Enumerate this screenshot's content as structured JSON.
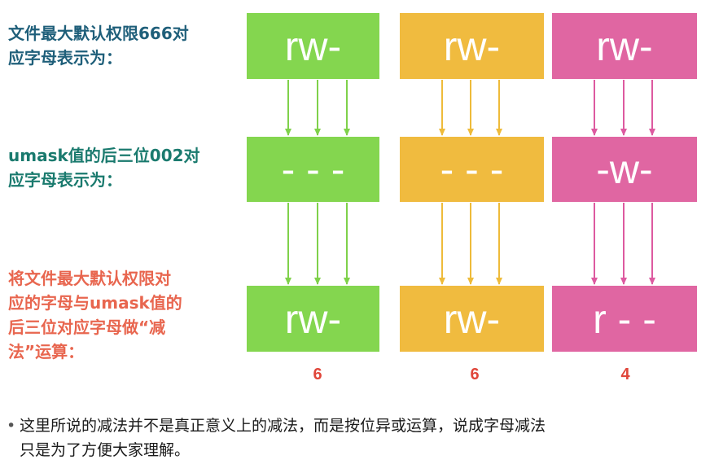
{
  "labels": {
    "row1": {
      "lines": [
        "文件最大默认权限666对",
        "应字母表示为："
      ],
      "color": "#1f5f7a"
    },
    "row2": {
      "lines": [
        "umask值的后三位002对",
        "应字母表示为："
      ],
      "color": "#1a7a6e"
    },
    "row3": {
      "lines": [
        "将文件最大默认权限对",
        "应的字母与umask值的",
        "后三位对应字母做“减",
        "法”运算："
      ],
      "color": "#e8664f"
    }
  },
  "columns": [
    {
      "color": "#84d64f",
      "arrow_color": "#7fd14a",
      "row1": "rw-",
      "row2": "- - -",
      "row3": "rw-",
      "value": "6"
    },
    {
      "color": "#f0bb3f",
      "arrow_color": "#eebb3a",
      "row1": "rw-",
      "row2": "- - -",
      "row3": "rw-",
      "value": "6"
    },
    {
      "color": "#e066a2",
      "arrow_color": "#dd5aa0",
      "row1": "rw-",
      "row2": "-w-",
      "row3": "r - -",
      "value": "4"
    }
  ],
  "note": {
    "bullet": "•",
    "lines": [
      "这里所说的减法并不是真正意义上的减法，而是按位异或运算，说成字母减法",
      "只是为了方便大家理解。"
    ]
  }
}
